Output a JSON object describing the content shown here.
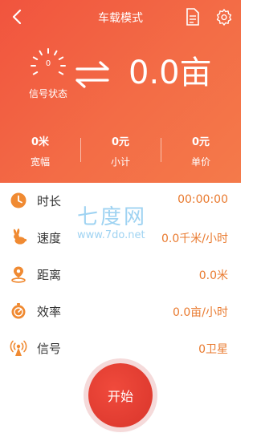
{
  "header": {
    "title": "车载模式",
    "signal_gauge_value": "0",
    "signal_status_label": "信号状态",
    "area_value": "0.0亩"
  },
  "stats": [
    {
      "value": "0米",
      "label": "宽幅"
    },
    {
      "value": "0元",
      "label": "小计"
    },
    {
      "value": "0元",
      "label": "单价"
    }
  ],
  "rows": [
    {
      "icon": "clock-icon",
      "label": "时长",
      "value": "00:00:00"
    },
    {
      "icon": "rabbit-icon",
      "label": "速度",
      "value": "0.0千米/小时"
    },
    {
      "icon": "location-pin-icon",
      "label": "距离",
      "value": "0.0米"
    },
    {
      "icon": "efficiency-icon",
      "label": "效率",
      "value": "0.0亩/小时"
    },
    {
      "icon": "satellite-signal-icon",
      "label": "信号",
      "value": "0卫星"
    }
  ],
  "watermark": {
    "name": "七度网",
    "url": "www.7do.net"
  },
  "start_button_label": "开始",
  "colors": {
    "header_gradient_start": "#f1543e",
    "header_gradient_end": "#f47a4a",
    "value_orange": "#e97a2f",
    "icon_orange": "#f08a32",
    "start_button": "#e2392e"
  }
}
